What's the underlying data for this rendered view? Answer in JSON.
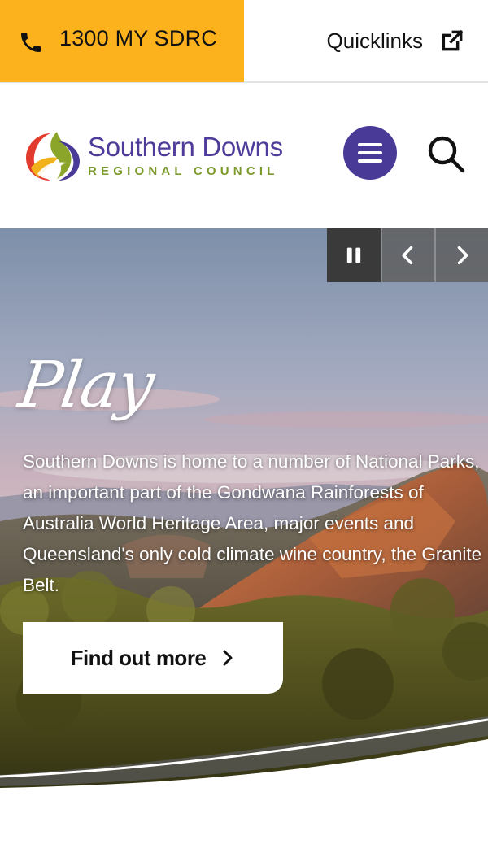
{
  "topbar": {
    "phone_label": "1300 MY SDRC",
    "quicklinks_label": "Quicklinks"
  },
  "header": {
    "logo_name": "Southern Downs",
    "logo_sub": "REGIONAL COUNCIL"
  },
  "hero": {
    "title": "Play",
    "text": "Southern Downs is home to a number of National Parks, an important part of the Gondwana Rainforests of Australia World Heritage Area, major events and Queensland's only cold climate wine country, the Granite Belt.",
    "button_label": "Find out more"
  },
  "colors": {
    "accent_yellow": "#fbb21c",
    "brand_purple": "#4a3a98",
    "brand_green": "#7c9a2b"
  }
}
